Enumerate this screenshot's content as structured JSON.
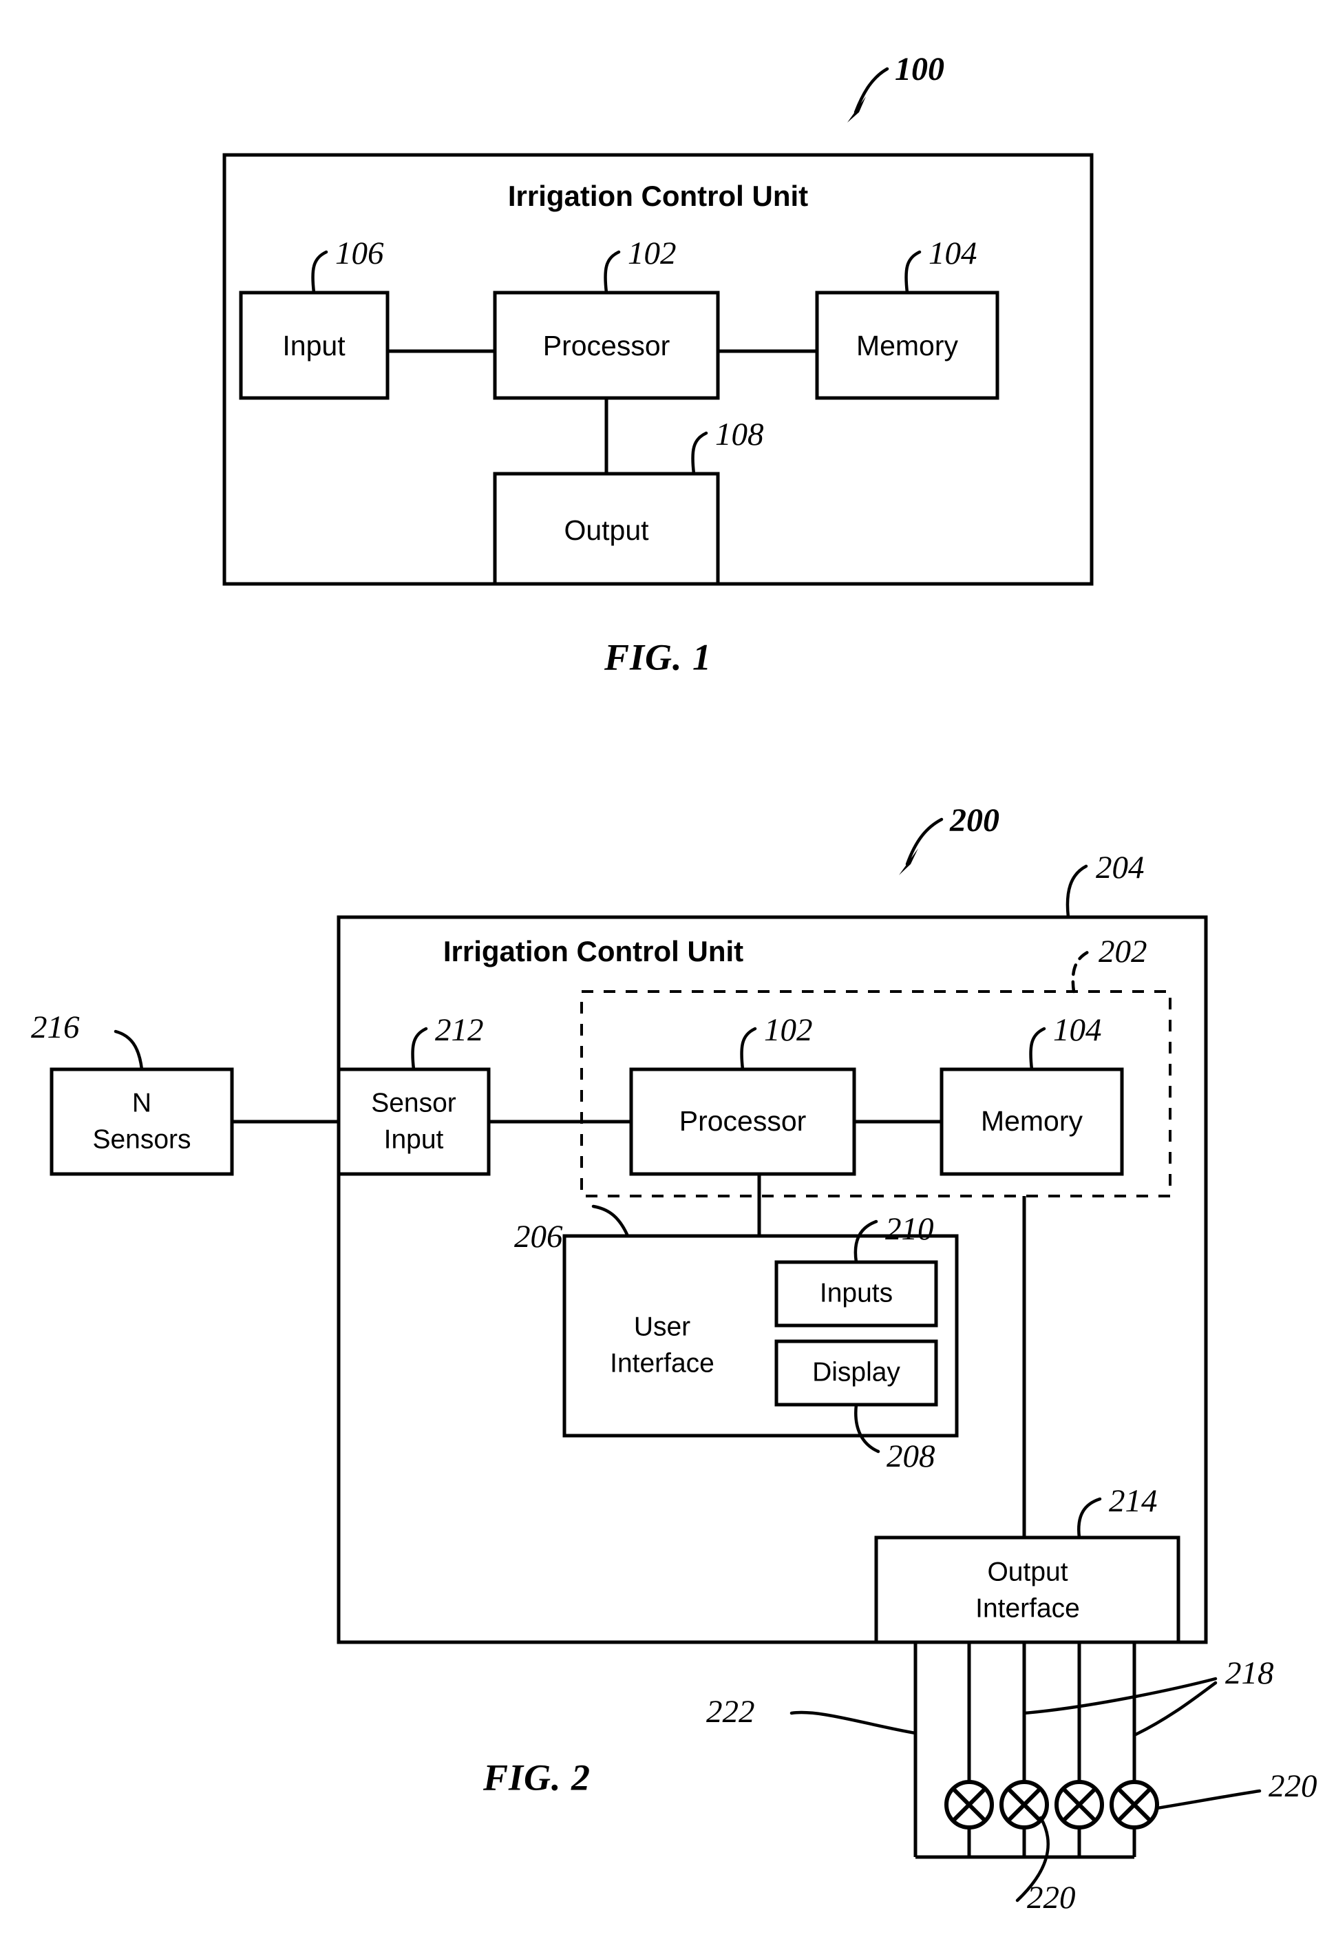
{
  "figures": [
    {
      "id": "fig1",
      "caption": "FIG. 1",
      "ref": "100",
      "unit_title": "Irrigation Control Unit",
      "blocks": [
        {
          "key": "input",
          "label": "Input",
          "ref": "106"
        },
        {
          "key": "processor",
          "label": "Processor",
          "ref": "102"
        },
        {
          "key": "memory",
          "label": "Memory",
          "ref": "104"
        },
        {
          "key": "output",
          "label": "Output",
          "ref": "108"
        }
      ]
    },
    {
      "id": "fig2",
      "caption": "FIG. 2",
      "ref": "200",
      "unit_title": "Irrigation Control Unit",
      "unit_ref": "204",
      "dashed_group_ref": "202",
      "blocks": [
        {
          "key": "n_sensors",
          "label_line1": "N",
          "label_line2": "Sensors",
          "ref": "216"
        },
        {
          "key": "sensor_input",
          "label_line1": "Sensor",
          "label_line2": "Input",
          "ref": "212"
        },
        {
          "key": "processor",
          "label_line1": "Processor",
          "label_line2": "",
          "ref": "102"
        },
        {
          "key": "memory",
          "label_line1": "Memory",
          "label_line2": "",
          "ref": "104"
        },
        {
          "key": "user_interface",
          "label_line1": "User",
          "label_line2": "Interface",
          "ref": "206"
        },
        {
          "key": "inputs",
          "label_line1": "Inputs",
          "label_line2": "",
          "ref": "210"
        },
        {
          "key": "display",
          "label_line1": "Display",
          "label_line2": "",
          "ref": "208"
        },
        {
          "key": "output_interface",
          "label_line1": "Output",
          "label_line2": "Interface",
          "ref": "214"
        }
      ],
      "wiring_refs": [
        {
          "key": "valve_lines",
          "ref": "218"
        },
        {
          "key": "valve_symbol",
          "ref": "220"
        },
        {
          "key": "valve_symbol_alt",
          "ref": "220"
        },
        {
          "key": "common_line",
          "ref": "222"
        }
      ],
      "valve_count": 4
    }
  ],
  "colors": {
    "ink": "#000000",
    "paper": "#ffffff"
  }
}
